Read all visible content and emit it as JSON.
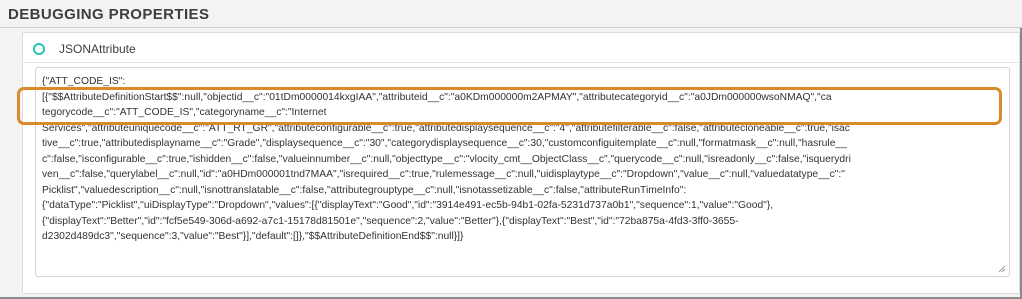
{
  "section": {
    "title": "DEBUGGING PROPERTIES"
  },
  "attribute": {
    "name": "JSONAttribute"
  },
  "json_lines": [
    "{\"ATT_CODE_IS\":",
    "[{\"$$AttributeDefinitionStart$$\":null,\"objectid__c\":\"01tDm0000014kxgIAA\",\"attributeid__c\":\"a0KDm000000m2APMAY\",\"attributecategoryid__c\":\"a0JDm000000wsoNMAQ\",\"ca",
    "tegorycode__c\":\"ATT_CODE_IS\",\"categoryname__c\":\"Internet",
    "Services\",\"attributeuniquecode__c\":\"ATT_RT_GR\",\"attributeconfigurable__c\":true,\"attributedisplaysequence__c\":\"4\",\"attributefilterable__c\":false,\"attributecloneable__c\":true,\"isac",
    "tive__c\":true,\"attributedisplayname__c\":\"Grade\",\"displaysequence__c\":\"30\",\"categorydisplaysequence__c\":30,\"customconfiguitemplate__c\":null,\"formatmask__c\":null,\"hasrule__",
    "c\":false,\"isconfigurable__c\":true,\"ishidden__c\":false,\"valueinnumber__c\":null,\"objecttype__c\":\"vlocity_cmt__ObjectClass__c\",\"querycode__c\":null,\"isreadonly__c\":false,\"isquerydri",
    "ven__c\":false,\"querylabel__c\":null,\"id\":\"a0HDm000001tnd7MAA\",\"isrequired__c\":true,\"rulemessage__c\":null,\"uidisplaytype__c\":\"Dropdown\",\"value__c\":null,\"valuedatatype__c\":\"",
    "Picklist\",\"valuedescription__c\":null,\"isnottranslatable__c\":false,\"attributegrouptype__c\":null,\"isnotassetizable__c\":false,\"attributeRunTimeInfo\":",
    "{\"dataType\":\"Picklist\",\"uiDisplayType\":\"Dropdown\",\"values\":[{\"displayText\":\"Good\",\"id\":\"3914e491-ec5b-94b1-02fa-5231d737a0b1\",\"sequence\":1,\"value\":\"Good\"},",
    "{\"displayText\":\"Better\",\"id\":\"fcf5e549-306d-a692-a7c1-15178d81501e\",\"sequence\":2,\"value\":\"Better\"},{\"displayText\":\"Best\",\"id\":\"72ba875a-4fd3-3ff0-3655-",
    "d2302d489dc3\",\"sequence\":3,\"value\":\"Best\"}],\"default\":[]},\"$$AttributeDefinitionEnd$$\":null}]}"
  ],
  "colors": {
    "highlight": "#d98a2b",
    "radio": "#26c6b6"
  }
}
